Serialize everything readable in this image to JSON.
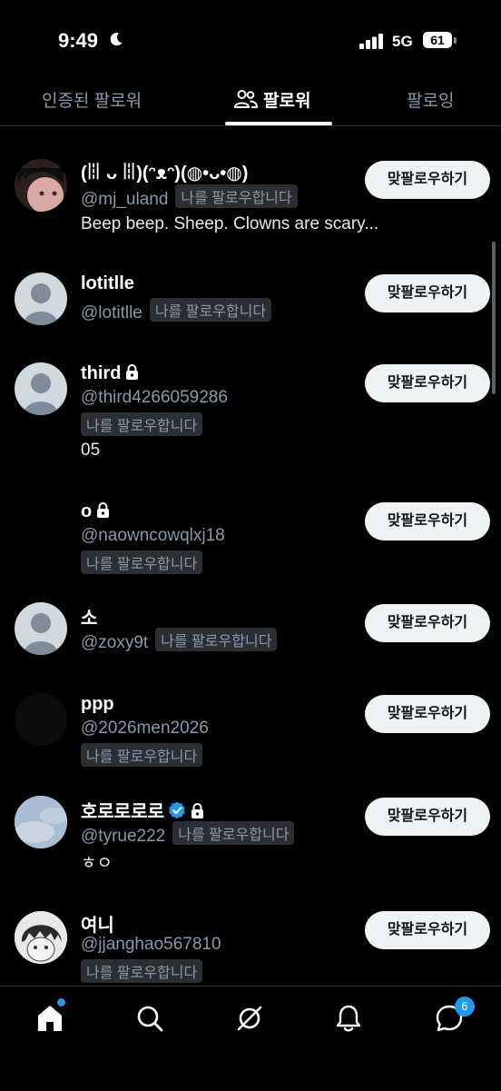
{
  "status_bar": {
    "time": "9:49",
    "network": "5G",
    "battery": "61"
  },
  "tabs": [
    {
      "label": "인증된 팔로워"
    },
    {
      "label": "팔로워"
    },
    {
      "label": "팔로잉"
    }
  ],
  "follows_you_label": "나를 팔로우합니다",
  "follow_back_label": "맞팔로우하기",
  "users": [
    {
      "name": "(ꈨ ᴗ ꈨ)(ᵔᴥᵔ)(◍•ᴗ•◍)",
      "handle": "@mj_uland",
      "bio": "Beep beep. Sheep. Clowns are scary..."
    },
    {
      "name": "lotitlle",
      "handle": "@lotitlle"
    },
    {
      "name": "third",
      "handle": "@third4266059286",
      "bio": "05"
    },
    {
      "name": "o",
      "handle": "@naowncowqlxj18"
    },
    {
      "name": "소",
      "handle": "@zoxy9t"
    },
    {
      "name": "ppp",
      "handle": "@2026men2026"
    },
    {
      "name": "호로로로로",
      "handle": "@tyrue222",
      "bio": "ㅎㅇ"
    },
    {
      "name": "여니",
      "handle": "@jjanghao567810"
    }
  ],
  "bottom_nav": {
    "items": [
      "home-icon",
      "search-icon",
      "grok-icon",
      "notifications-icon",
      "messages-icon"
    ],
    "messages_count": "6"
  },
  "colors": {
    "accent": "#1d9bf0",
    "background": "#000000",
    "button_bg": "#eff3f4",
    "muted_text": "#8b98a5"
  }
}
